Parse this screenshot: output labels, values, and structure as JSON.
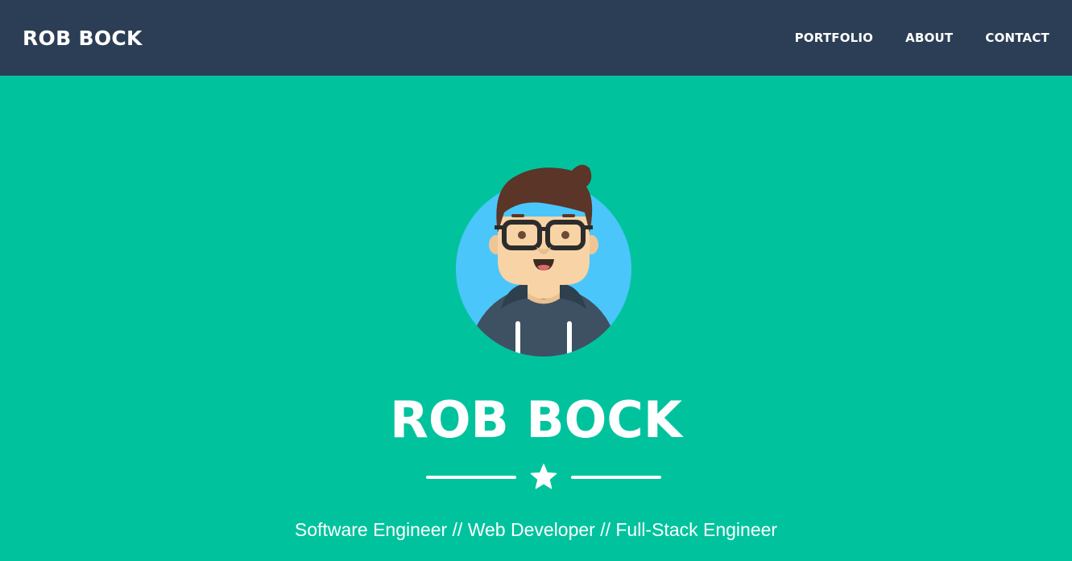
{
  "navbar": {
    "brand": "ROB BOCK",
    "links": [
      "PORTFOLIO",
      "ABOUT",
      "CONTACT"
    ]
  },
  "hero": {
    "avatar_icon": "developer-avatar-icon",
    "title": "ROB BOCK",
    "divider_icon": "star-icon",
    "subtitle": "Software Engineer // Web Developer // Full-Stack Engineer"
  },
  "colors": {
    "navbar_bg": "#2c3e55",
    "hero_bg": "#00c39e",
    "avatar_circle": "#4ac6fb",
    "text": "#ffffff"
  }
}
